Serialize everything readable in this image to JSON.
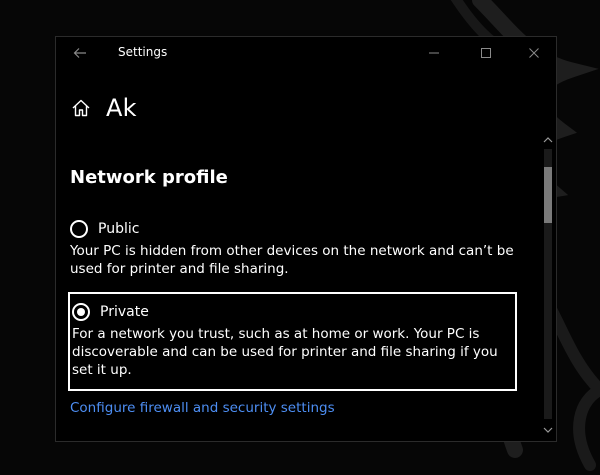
{
  "window": {
    "title": "Settings",
    "controls": {
      "minimize_icon": "minimize-icon",
      "maximize_icon": "maximize-icon",
      "close_icon": "close-icon"
    }
  },
  "header": {
    "home_icon": "home-icon",
    "title": "Ak"
  },
  "network_profile": {
    "section_title": "Network profile",
    "options": [
      {
        "label": "Public",
        "selected": false,
        "description": "Your PC is hidden from other devices on the network and can’t be used for printer and file sharing."
      },
      {
        "label": "Private",
        "selected": true,
        "description": "For a network you trust, such as at home or work. Your PC is discoverable and can be used for printer and file sharing if you set it up."
      }
    ],
    "firewall_link": "Configure firewall and security settings"
  },
  "colors": {
    "background": "#000000",
    "text": "#ffffff",
    "link": "#4d8ef3",
    "focus_border": "#ffffff",
    "scroll_thumb": "#7a7a7a"
  }
}
